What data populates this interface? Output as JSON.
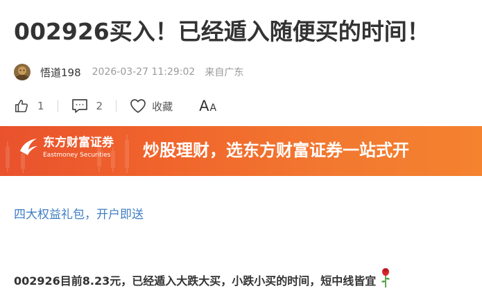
{
  "article": {
    "title": "002926买入！已经遁入随便买的时间！",
    "author": "悟道198",
    "datetime": "2026-03-27 11:29:02",
    "location": "来自广东",
    "likes": "1",
    "comments": "2",
    "favorite_label": "收藏",
    "font_size_big": "A",
    "font_size_small": "A"
  },
  "banner": {
    "brand_cn": "东方财富证券",
    "brand_en": "Eastmoney Securities",
    "slogan": "炒股理财，选东方财富证券一站式开"
  },
  "promo_link": "四大权益礼包，开户即送",
  "content": {
    "paragraph": "002926目前8.23元，已经遁入大跌大买，小跌小买的时间，短中线皆宜",
    "emoji": "rose-icon"
  },
  "colors": {
    "banner_start": "#e9522d",
    "banner_end": "#f4822f",
    "link": "#3f7dc5",
    "muted": "#9a9a9a"
  }
}
